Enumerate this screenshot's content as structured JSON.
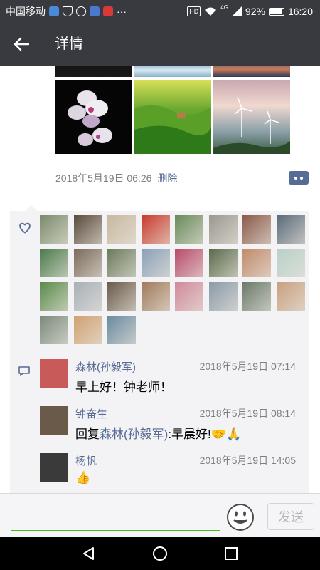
{
  "status_bar": {
    "carrier": "中国移动",
    "more": "···",
    "hd": "HD",
    "network": "4G",
    "battery": "92%",
    "time": "16:20"
  },
  "header": {
    "title": "详情",
    "back_icon": "arrow-left-icon"
  },
  "post": {
    "date": "2018年5月19日 06:26",
    "delete_label": "删除",
    "comment_icon": "more-dots-icon",
    "photo_themes": [
      "dark-photo",
      "sky-water-photo",
      "lake-sunset-photo",
      "white-orchid-photo",
      "green-hills-photo",
      "wind-turbines-photo"
    ]
  },
  "likes": {
    "icon": "heart-outline-icon",
    "count": 26,
    "avatar_colors": [
      "#7a8a6a",
      "#5a4a3a",
      "#c8b8a0",
      "#c83a2a",
      "#6a8a5a",
      "#9a9890",
      "#8a5a4a",
      "#5a6a7a",
      "#4a7a4a",
      "#7a6a5a",
      "#6a7a5a",
      "#8aa0b8",
      "#b84a6a",
      "#5a6a4a",
      "#c08a6a",
      "#b8d0c8",
      "#5a8a4a",
      "#a8b0b8",
      "#6a5a4a",
      "#a07a5a",
      "#d08a9a",
      "#8a9aa8",
      "#6a7a6a",
      "#c8a080",
      "#7a8a7a",
      "#d0a070",
      "#6a8aa0"
    ]
  },
  "comments": [
    {
      "name": "森林(孙毅军)",
      "time": "2018年5月19日 07:14",
      "text": "早上好！钟老师！",
      "avatar_color": "#c85a5a"
    },
    {
      "name": "钟奋生",
      "time": "2018年5月19日 08:14",
      "reply_prefix": "回复",
      "reply_to": "森林(孙毅军)",
      "reply_text": ":早晨好!",
      "emoji": "🤝🙏",
      "avatar_color": "#6a5a4a"
    },
    {
      "name": "杨帆",
      "time": "2018年5月19日 14:05",
      "emoji": "👍",
      "avatar_color": "#3a3a3a"
    }
  ],
  "input": {
    "placeholder": "",
    "emoji_icon": "smiley-face-icon",
    "send_label": "发送"
  },
  "nav": {
    "back_icon": "nav-back-triangle-icon",
    "home_icon": "nav-home-circle-icon",
    "recent_icon": "nav-recent-square-icon"
  }
}
